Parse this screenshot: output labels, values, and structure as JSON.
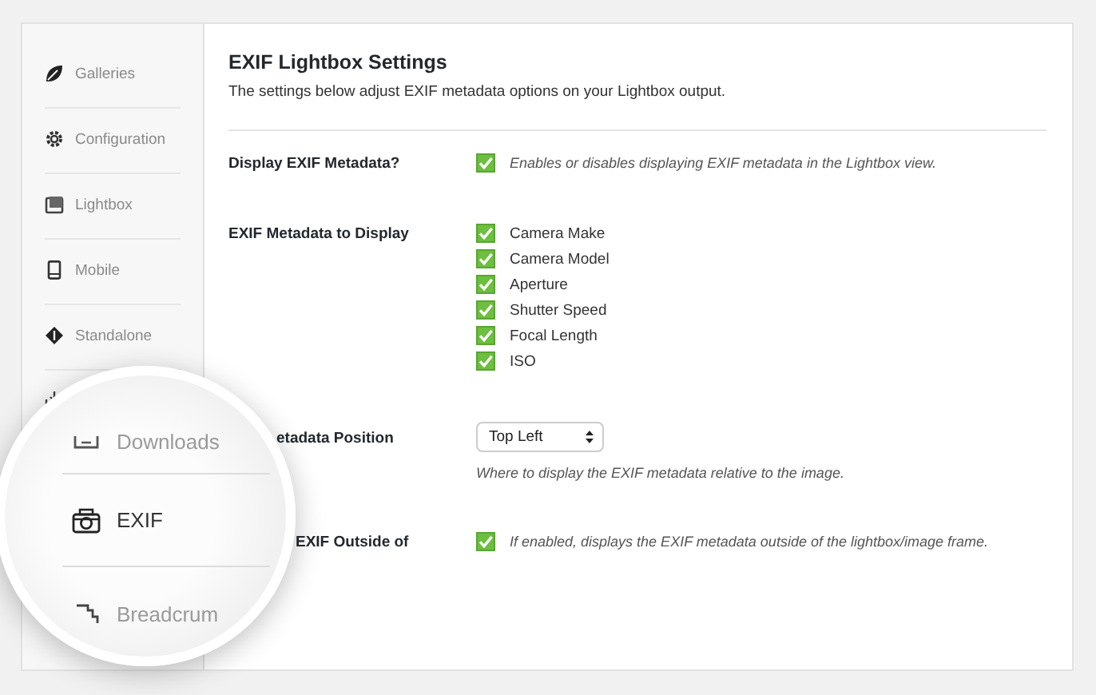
{
  "sidebar": {
    "items": [
      {
        "label": "Galleries",
        "selected": false
      },
      {
        "label": "Configuration",
        "selected": false
      },
      {
        "label": "Lightbox",
        "selected": false
      },
      {
        "label": "Mobile",
        "selected": false
      },
      {
        "label": "Standalone",
        "selected": false
      }
    ]
  },
  "settings": {
    "title": "EXIF Lightbox Settings",
    "description": "The settings below adjust EXIF metadata options on your Lightbox output.",
    "rows": [
      {
        "kind": "checkbox",
        "label": "Display EXIF Metadata?",
        "checked": true,
        "help": "Enables or disables displaying EXIF metadata in the Lightbox view."
      },
      {
        "kind": "checklist",
        "label": "EXIF Metadata to Display",
        "options": [
          {
            "label": "Camera Make",
            "checked": true
          },
          {
            "label": "Camera Model",
            "checked": true
          },
          {
            "label": "Aperture",
            "checked": true
          },
          {
            "label": "Shutter Speed",
            "checked": true
          },
          {
            "label": "Focal Length",
            "checked": true
          },
          {
            "label": "ISO",
            "checked": true
          }
        ]
      },
      {
        "kind": "select",
        "label": "etadata Position",
        "value": "Top Left",
        "help": "Where to display the EXIF metadata relative to the image."
      },
      {
        "kind": "checkbox",
        "label": "EXIF Outside of",
        "checked": true,
        "help": "If enabled, displays the EXIF metadata outside of the lightbox/image frame."
      }
    ]
  },
  "magnifier": {
    "items": [
      {
        "label": "Downloads",
        "selected": false
      },
      {
        "label": "EXIF",
        "selected": true
      },
      {
        "label": "Breadcrum",
        "selected": false
      }
    ]
  }
}
